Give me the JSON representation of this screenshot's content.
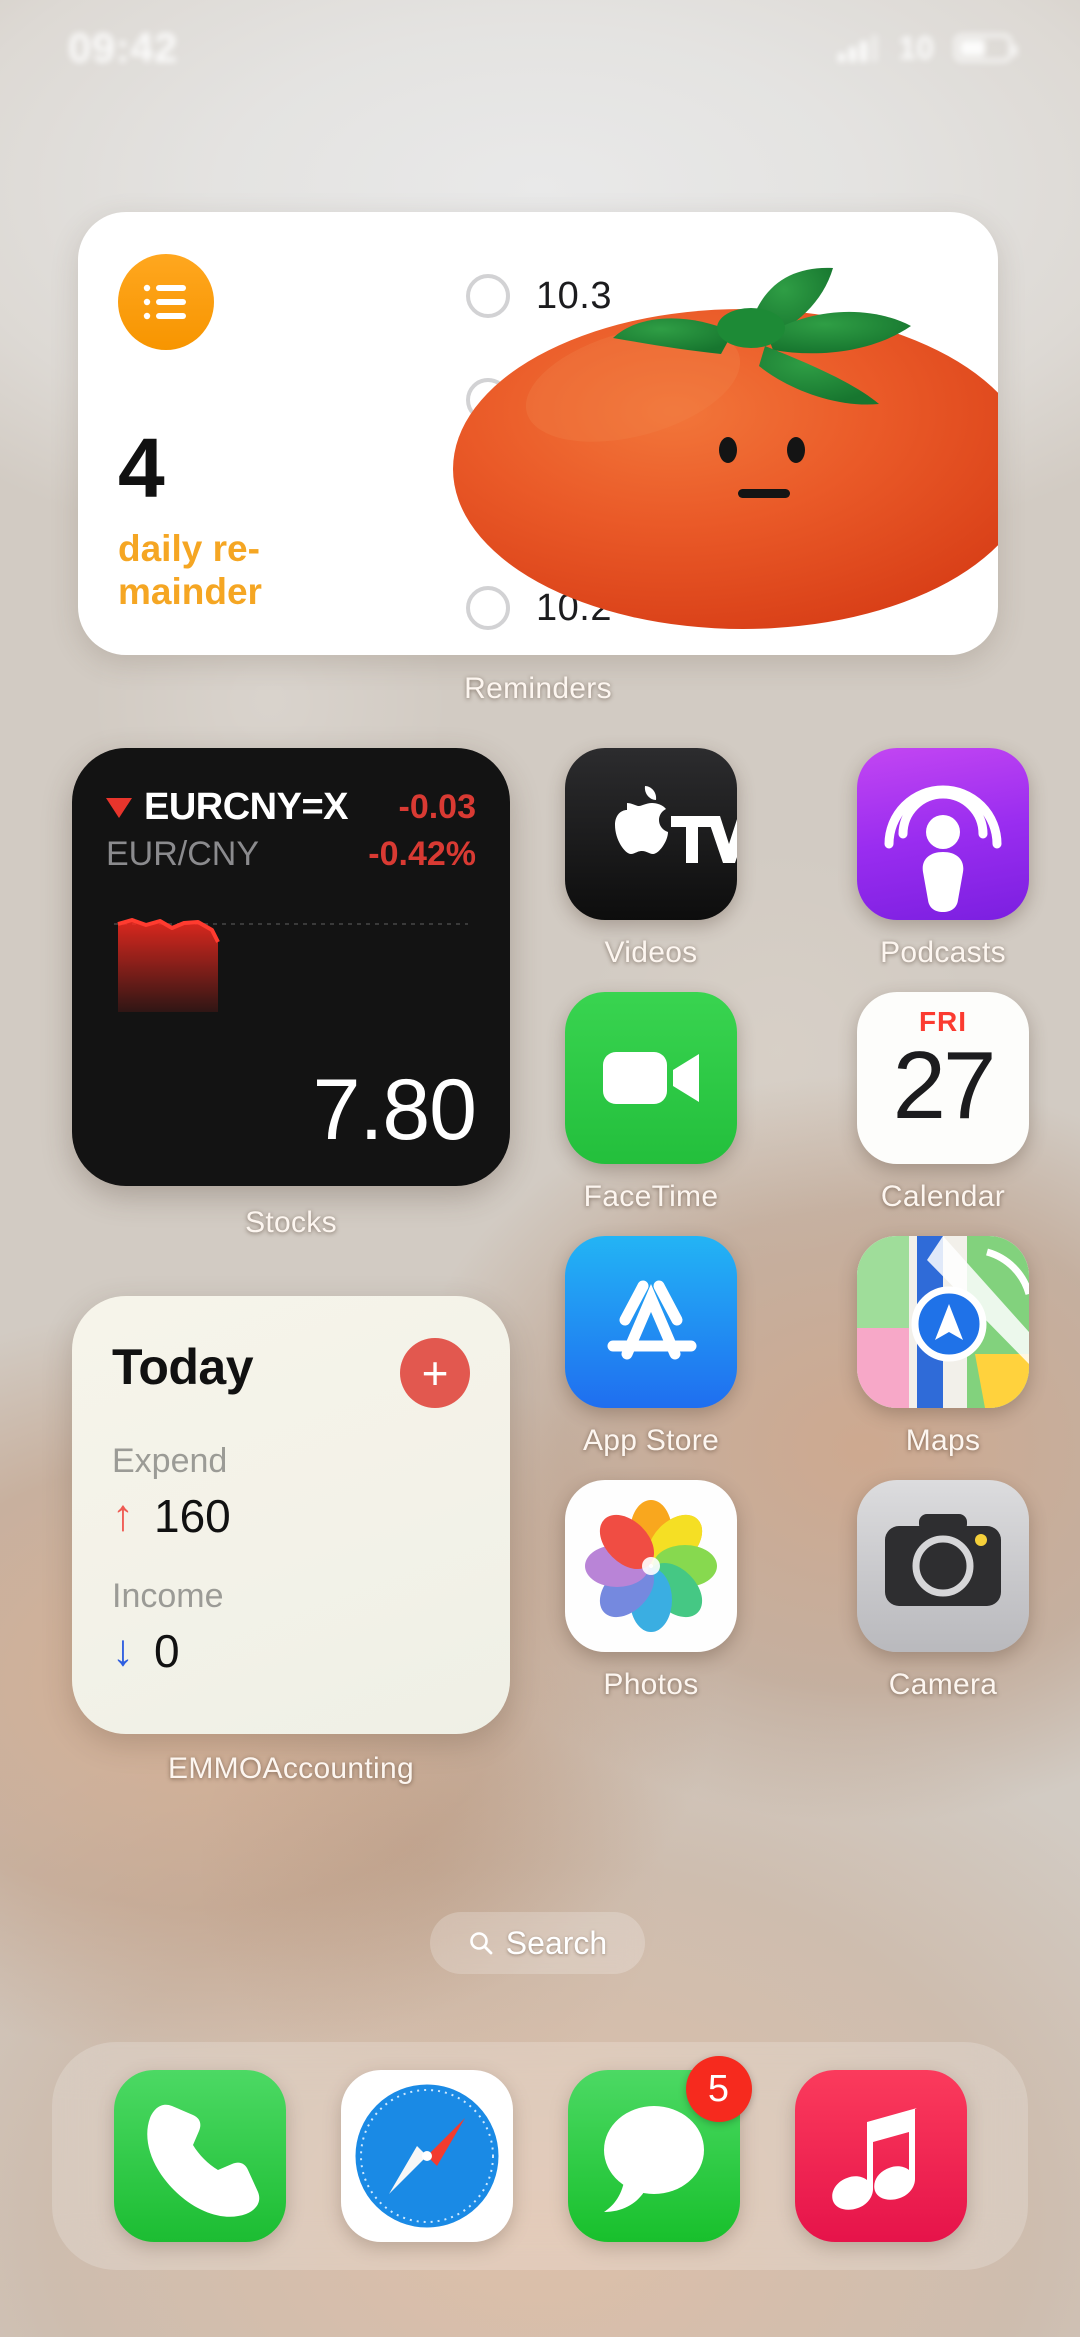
{
  "status_bar": {
    "time": "09:42",
    "network_label": "10",
    "signal_icon": "signal-bars-icon",
    "battery_icon": "battery-icon"
  },
  "reminders_widget": {
    "app_label": "Reminders",
    "icon_name": "reminders-list-icon",
    "count": "4",
    "subtitle": "daily re-\nmainder",
    "subtitle_line1": "daily re-",
    "subtitle_line2": "mainder",
    "tasks": [
      {
        "text": "10.3",
        "checked": false
      },
      {
        "text": "",
        "checked": false
      },
      {
        "text": "",
        "checked": false
      },
      {
        "text": "10.2",
        "checked": false
      }
    ],
    "sticker": "tomato-sticker"
  },
  "stocks_widget": {
    "app_label": "Stocks",
    "trend_icon": "caret-down-icon",
    "symbol": "EURCNY=X",
    "change": "-0.03",
    "pair_name": "EUR/CNY",
    "change_percent": "-0.42%",
    "price": "7.80",
    "accent_color": "#d93a33"
  },
  "accounting_widget": {
    "app_label": "EMMOAccounting",
    "title": "Today",
    "add_button_icon": "plus-icon",
    "expend_label": "Expend",
    "expend_value": "160",
    "expend_arrow": "arrow-up-icon",
    "income_label": "Income",
    "income_value": "0",
    "income_arrow": "arrow-down-icon",
    "expend_color": "#ef5a52",
    "income_color": "#2f5fe0"
  },
  "app_grid": {
    "rows": [
      [
        {
          "label": "Videos",
          "icon": "apple-tv-icon"
        },
        {
          "label": "Podcasts",
          "icon": "podcasts-icon"
        }
      ],
      [
        {
          "label": "FaceTime",
          "icon": "facetime-icon"
        },
        {
          "label": "Calendar",
          "icon": "calendar-icon",
          "day": "FRI",
          "date": "27"
        }
      ],
      [
        {
          "label": "App Store",
          "icon": "app-store-icon"
        },
        {
          "label": "Maps",
          "icon": "maps-icon"
        }
      ],
      [
        {
          "label": "Photos",
          "icon": "photos-icon"
        },
        {
          "label": "Camera",
          "icon": "camera-icon"
        }
      ]
    ]
  },
  "search": {
    "label": "Search",
    "icon": "search-icon"
  },
  "dock": {
    "items": [
      {
        "name": "Phone",
        "icon": "phone-icon",
        "badge": ""
      },
      {
        "name": "Safari",
        "icon": "safari-icon",
        "badge": ""
      },
      {
        "name": "Messages",
        "icon": "messages-icon",
        "badge": "5"
      },
      {
        "name": "Music",
        "icon": "music-icon",
        "badge": ""
      }
    ]
  }
}
